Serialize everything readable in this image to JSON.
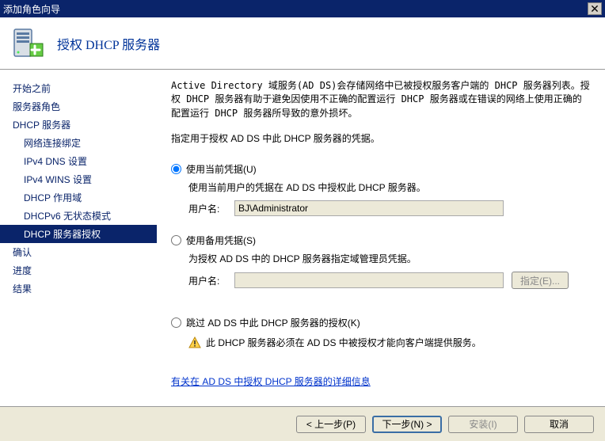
{
  "window": {
    "title": "添加角色向导"
  },
  "header": {
    "title": "授权 DHCP 服务器"
  },
  "sidebar": {
    "items": [
      {
        "label": "开始之前",
        "sub": false,
        "selected": false
      },
      {
        "label": "服务器角色",
        "sub": false,
        "selected": false
      },
      {
        "label": "DHCP 服务器",
        "sub": false,
        "selected": false
      },
      {
        "label": "网络连接绑定",
        "sub": true,
        "selected": false
      },
      {
        "label": "IPv4 DNS 设置",
        "sub": true,
        "selected": false
      },
      {
        "label": "IPv4 WINS 设置",
        "sub": true,
        "selected": false
      },
      {
        "label": "DHCP 作用域",
        "sub": true,
        "selected": false
      },
      {
        "label": "DHCPv6 无状态模式",
        "sub": true,
        "selected": false
      },
      {
        "label": "DHCP 服务器授权",
        "sub": true,
        "selected": true
      },
      {
        "label": "确认",
        "sub": false,
        "selected": false
      },
      {
        "label": "进度",
        "sub": false,
        "selected": false
      },
      {
        "label": "结果",
        "sub": false,
        "selected": false
      }
    ]
  },
  "main": {
    "intro": "Active Directory 域服务(AD DS)会存储网络中已被授权服务客户端的 DHCP 服务器列表。授权 DHCP 服务器有助于避免因使用不正确的配置运行 DHCP 服务器或在错误的网络上使用正确的配置运行 DHCP 服务器所导致的意外损坏。",
    "instruct": "指定用于授权 AD DS 中此 DHCP 服务器的凭据。",
    "option1": {
      "label": "使用当前凭据(U)",
      "desc": "使用当前用户的凭据在 AD DS 中授权此 DHCP 服务器。",
      "user_label": "用户名:",
      "user_value": "BJ\\Administrator"
    },
    "option2": {
      "label": "使用备用凭据(S)",
      "desc": "为授权 AD DS 中的 DHCP 服务器指定域管理员凭据。",
      "user_label": "用户名:",
      "user_value": "",
      "specify_btn": "指定(E)..."
    },
    "option3": {
      "label": "跳过 AD DS 中此 DHCP 服务器的授权(K)",
      "warning": "此 DHCP 服务器必须在 AD DS 中被授权才能向客户端提供服务。"
    },
    "link": "有关在 AD DS 中授权 DHCP 服务器的详细信息"
  },
  "footer": {
    "prev": "< 上一步(P)",
    "next": "下一步(N) >",
    "install": "安装(I)",
    "cancel": "取消"
  }
}
